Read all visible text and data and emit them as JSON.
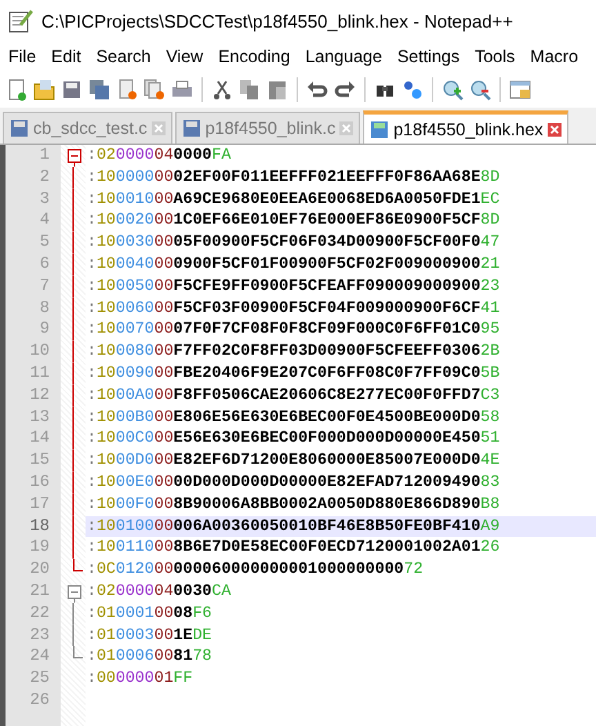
{
  "window": {
    "title": "C:\\PICProjects\\SDCCTest\\p18f4550_blink.hex - Notepad++"
  },
  "menu": [
    "File",
    "Edit",
    "Search",
    "View",
    "Encoding",
    "Language",
    "Settings",
    "Tools",
    "Macro"
  ],
  "toolbar": [
    {
      "kind": "new"
    },
    {
      "kind": "open"
    },
    {
      "kind": "save"
    },
    {
      "kind": "save-all"
    },
    {
      "kind": "close"
    },
    {
      "kind": "close-all"
    },
    {
      "kind": "print"
    },
    {
      "kind": "sep"
    },
    {
      "kind": "cut"
    },
    {
      "kind": "copy"
    },
    {
      "kind": "paste"
    },
    {
      "kind": "sep"
    },
    {
      "kind": "undo"
    },
    {
      "kind": "redo"
    },
    {
      "kind": "sep"
    },
    {
      "kind": "find"
    },
    {
      "kind": "replace"
    },
    {
      "kind": "sep"
    },
    {
      "kind": "zoom-in"
    },
    {
      "kind": "zoom-out"
    },
    {
      "kind": "sep"
    },
    {
      "kind": "window"
    }
  ],
  "tabs": [
    {
      "label": "cb_sdcc_test.c",
      "selected": false
    },
    {
      "label": "p18f4550_blink.c",
      "selected": false
    },
    {
      "label": "p18f4550_blink.hex",
      "selected": true
    }
  ],
  "lines": [
    {
      "number": "1",
      "fold_header": true,
      "fold_body": false,
      "fold_end": false,
      "selected": false,
      "kind": "ext",
      "start": ":",
      "count": "02",
      "address": "0000",
      "type": "04",
      "data": "0000",
      "checksum": "FA"
    },
    {
      "number": "2",
      "fold_header": false,
      "fold_body": true,
      "fold_end": false,
      "selected": false,
      "kind": "data",
      "start": ":",
      "count": "10",
      "address": "0000",
      "type": "00",
      "data": "02EF00F011EEFFF021EEFFF0F86AA68E",
      "checksum": "8D"
    },
    {
      "number": "3",
      "fold_header": false,
      "fold_body": true,
      "fold_end": false,
      "selected": false,
      "kind": "data",
      "start": ":",
      "count": "10",
      "address": "0010",
      "type": "00",
      "data": "A69CE9680E0EEA6E0068ED6A0050FDE1",
      "checksum": "EC"
    },
    {
      "number": "4",
      "fold_header": false,
      "fold_body": true,
      "fold_end": false,
      "selected": false,
      "kind": "data",
      "start": ":",
      "count": "10",
      "address": "0020",
      "type": "00",
      "data": "1C0EF66E010EF76E000EF86E0900F5CF",
      "checksum": "8D"
    },
    {
      "number": "5",
      "fold_header": false,
      "fold_body": true,
      "fold_end": false,
      "selected": false,
      "kind": "data",
      "start": ":",
      "count": "10",
      "address": "0030",
      "type": "00",
      "data": "05F00900F5CF06F034D00900F5CF00F0",
      "checksum": "47"
    },
    {
      "number": "6",
      "fold_header": false,
      "fold_body": true,
      "fold_end": false,
      "selected": false,
      "kind": "data",
      "start": ":",
      "count": "10",
      "address": "0040",
      "type": "00",
      "data": "0900F5CF01F00900F5CF02F009000900",
      "checksum": "21"
    },
    {
      "number": "7",
      "fold_header": false,
      "fold_body": true,
      "fold_end": false,
      "selected": false,
      "kind": "data",
      "start": ":",
      "count": "10",
      "address": "0050",
      "type": "00",
      "data": "F5CFE9FF0900F5CFEAFF090009000900",
      "checksum": "23"
    },
    {
      "number": "8",
      "fold_header": false,
      "fold_body": true,
      "fold_end": false,
      "selected": false,
      "kind": "data",
      "start": ":",
      "count": "10",
      "address": "0060",
      "type": "00",
      "data": "F5CF03F00900F5CF04F009000900F6CF",
      "checksum": "41"
    },
    {
      "number": "9",
      "fold_header": false,
      "fold_body": true,
      "fold_end": false,
      "selected": false,
      "kind": "data",
      "start": ":",
      "count": "10",
      "address": "0070",
      "type": "00",
      "data": "07F0F7CF08F0F8CF09F000C0F6FF01C0",
      "checksum": "95"
    },
    {
      "number": "10",
      "fold_header": false,
      "fold_body": true,
      "fold_end": false,
      "selected": false,
      "kind": "data",
      "start": ":",
      "count": "10",
      "address": "0080",
      "type": "00",
      "data": "F7FF02C0F8FF03D00900F5CFEEFF0306",
      "checksum": "2B"
    },
    {
      "number": "11",
      "fold_header": false,
      "fold_body": true,
      "fold_end": false,
      "selected": false,
      "kind": "data",
      "start": ":",
      "count": "10",
      "address": "0090",
      "type": "00",
      "data": "FBE20406F9E207C0F6FF08C0F7FF09C0",
      "checksum": "5B"
    },
    {
      "number": "12",
      "fold_header": false,
      "fold_body": true,
      "fold_end": false,
      "selected": false,
      "kind": "data",
      "start": ":",
      "count": "10",
      "address": "00A0",
      "type": "00",
      "data": "F8FF0506CAE20606C8E277EC00F0FFD7",
      "checksum": "C3"
    },
    {
      "number": "13",
      "fold_header": false,
      "fold_body": true,
      "fold_end": false,
      "selected": false,
      "kind": "data",
      "start": ":",
      "count": "10",
      "address": "00B0",
      "type": "00",
      "data": "E806E56E630E6BEC00F0E4500BE000D0",
      "checksum": "58"
    },
    {
      "number": "14",
      "fold_header": false,
      "fold_body": true,
      "fold_end": false,
      "selected": false,
      "kind": "data",
      "start": ":",
      "count": "10",
      "address": "00C0",
      "type": "00",
      "data": "E56E630E6BEC00F000D000D00000E450",
      "checksum": "51"
    },
    {
      "number": "15",
      "fold_header": false,
      "fold_body": true,
      "fold_end": false,
      "selected": false,
      "kind": "data",
      "start": ":",
      "count": "10",
      "address": "00D0",
      "type": "00",
      "data": "E82EF6D71200E8060000E85007E000D0",
      "checksum": "4E"
    },
    {
      "number": "16",
      "fold_header": false,
      "fold_body": true,
      "fold_end": false,
      "selected": false,
      "kind": "data",
      "start": ":",
      "count": "10",
      "address": "00E0",
      "type": "00",
      "data": "00D000D000D00000E82EFAD712009490",
      "checksum": "83"
    },
    {
      "number": "17",
      "fold_header": false,
      "fold_body": true,
      "fold_end": false,
      "selected": false,
      "kind": "data",
      "start": ":",
      "count": "10",
      "address": "00F0",
      "type": "00",
      "data": "8B90006A8BB0002A0050D880E866D890",
      "checksum": "B8"
    },
    {
      "number": "18",
      "fold_header": false,
      "fold_body": true,
      "fold_end": false,
      "selected": true,
      "kind": "data",
      "start": ":",
      "count": "10",
      "address": "0100",
      "type": "00",
      "data": "006A00360050010BF46E8B50FE0BF410",
      "checksum": "A9"
    },
    {
      "number": "19",
      "fold_header": false,
      "fold_body": true,
      "fold_end": false,
      "selected": false,
      "kind": "data",
      "start": ":",
      "count": "10",
      "address": "0110",
      "type": "00",
      "data": "8B6E7D0E58EC00F0ECD7120001002A01",
      "checksum": "26"
    },
    {
      "number": "20",
      "fold_header": false,
      "fold_body": false,
      "fold_end": true,
      "selected": false,
      "kind": "data",
      "start": ":",
      "count": "0C",
      "address": "0120",
      "type": "00",
      "data": "000060000000001000000000",
      "checksum": "72"
    },
    {
      "number": "21",
      "fold_header": true,
      "fold_body": false,
      "fold_end": false,
      "selected": false,
      "kind": "ext",
      "start": ":",
      "count": "02",
      "address": "0000",
      "type": "04",
      "data": "0030",
      "checksum": "CA"
    },
    {
      "number": "22",
      "fold_header": false,
      "fold_body": true,
      "fold_end": false,
      "selected": false,
      "kind": "data",
      "start": ":",
      "count": "01",
      "address": "0001",
      "type": "00",
      "data": "08",
      "checksum": "F6"
    },
    {
      "number": "23",
      "fold_header": false,
      "fold_body": true,
      "fold_end": false,
      "selected": false,
      "kind": "data",
      "start": ":",
      "count": "01",
      "address": "0003",
      "type": "00",
      "data": "1E",
      "checksum": "DE"
    },
    {
      "number": "24",
      "fold_header": false,
      "fold_body": false,
      "fold_end": true,
      "selected": false,
      "kind": "data",
      "start": ":",
      "count": "01",
      "address": "0006",
      "type": "00",
      "data": "81",
      "checksum": "78"
    },
    {
      "number": "25",
      "fold_header": false,
      "fold_body": false,
      "fold_end": false,
      "selected": false,
      "kind": "eof",
      "start": ":",
      "count": "00",
      "address": "0000",
      "type": "01",
      "checksum": "FF"
    },
    {
      "number": "26",
      "fold_header": false,
      "fold_body": false,
      "fold_end": false,
      "selected": false,
      "kind": "empty"
    }
  ]
}
